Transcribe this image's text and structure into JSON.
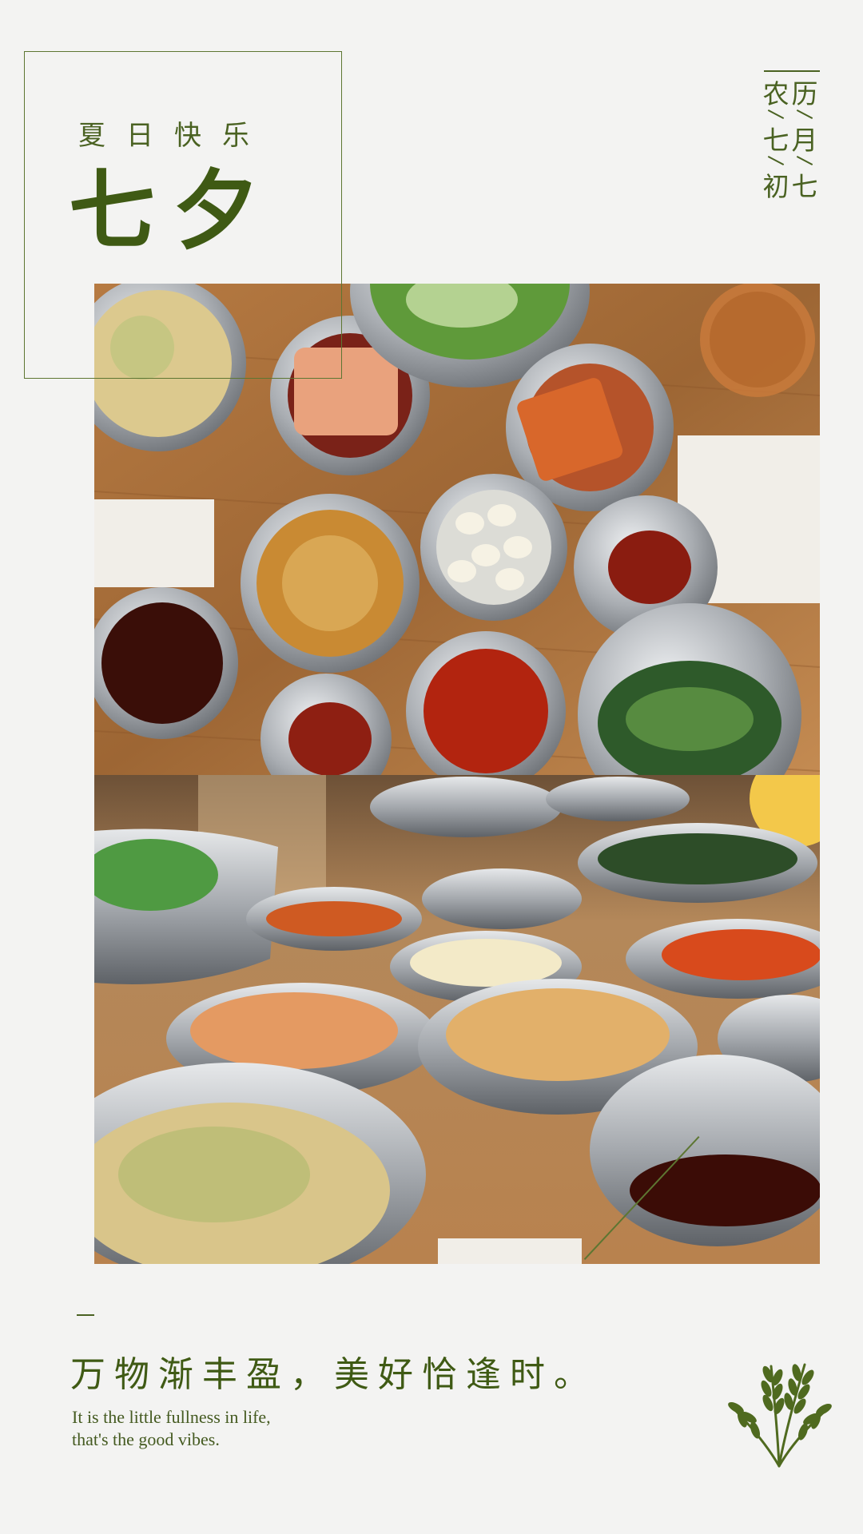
{
  "header": {
    "subtitle": "夏日快乐",
    "title": "七夕"
  },
  "lunar_date": {
    "left_column": [
      "农",
      "七",
      "初"
    ],
    "right_column": [
      "历",
      "月",
      "七"
    ]
  },
  "photos": [
    {
      "name": "korean-banchan-top-view"
    },
    {
      "name": "korean-banchan-side-view"
    }
  ],
  "footer": {
    "slogan": "万物渐丰盈，美好恰逢时。",
    "english_line1": "It is the little fullness in life,",
    "english_line2": "that's the good vibes."
  },
  "colors": {
    "accent": "#47601f",
    "background": "#f3f3f2"
  },
  "icons": [
    "wheat-icon"
  ]
}
